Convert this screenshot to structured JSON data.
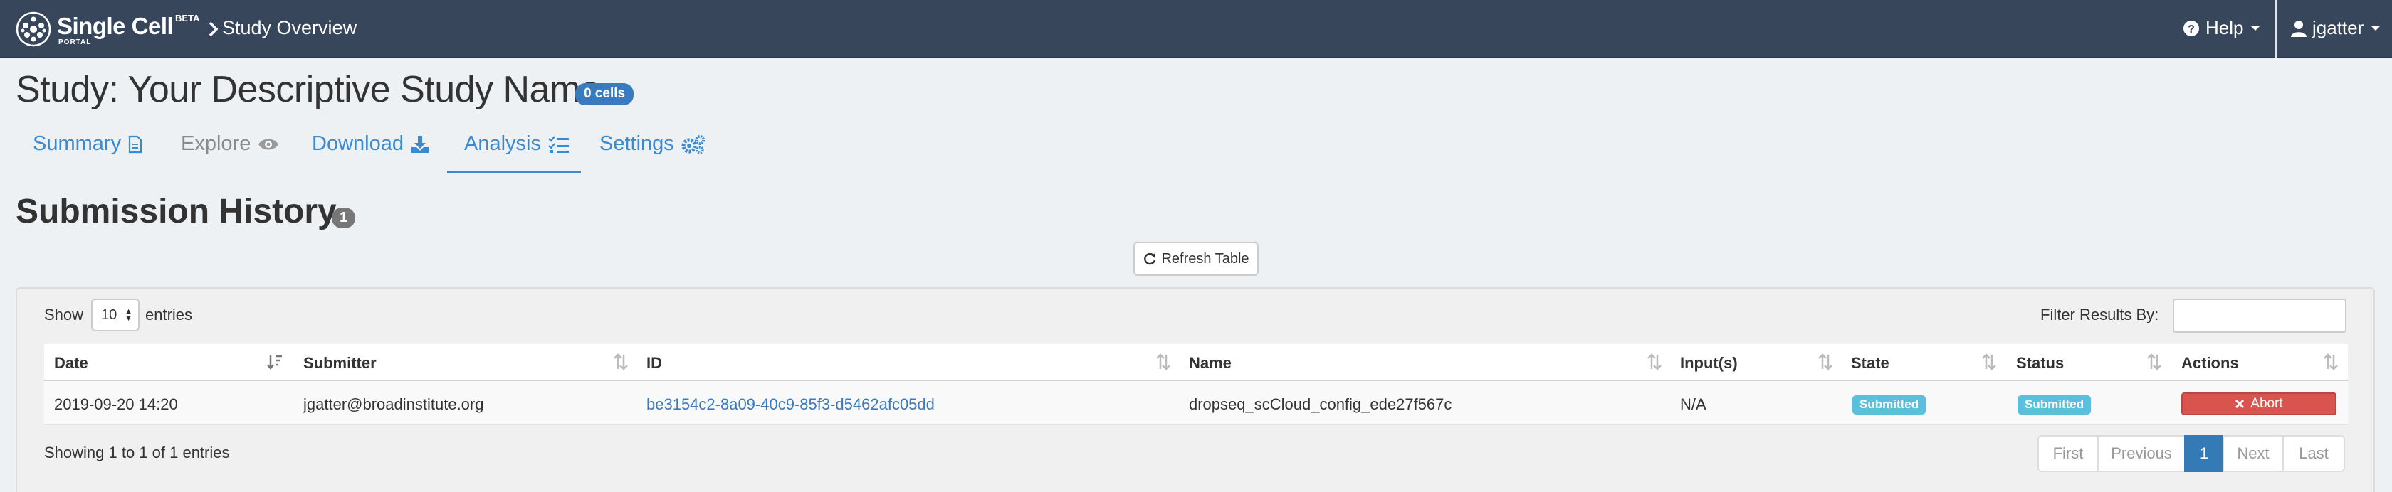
{
  "navbar": {
    "brand_name": "Single Cell",
    "brand_beta": "BETA",
    "brand_portal": "PORTAL",
    "breadcrumb": "Study Overview",
    "help_label": "Help",
    "user_label": "jgatter"
  },
  "study": {
    "title": "Study: Your Descriptive Study Name",
    "cells_badge": "0 cells"
  },
  "tabs": [
    {
      "label": "Summary",
      "icon": "file-icon"
    },
    {
      "label": "Explore",
      "icon": "eye-icon"
    },
    {
      "label": "Download",
      "icon": "download-icon"
    },
    {
      "label": "Analysis",
      "icon": "tasks-icon",
      "active": true
    },
    {
      "label": "Settings",
      "icon": "cogs-icon"
    }
  ],
  "submission_history": {
    "title": "Submission History",
    "count": "1",
    "refresh_label": "Refresh Table",
    "show_label": "Show",
    "entries_per_page": "10",
    "entries_label": "entries",
    "filter_label": "Filter Results By:",
    "filter_value": "",
    "columns": [
      "Date",
      "Submitter",
      "ID",
      "Name",
      "Input(s)",
      "State",
      "Status",
      "Actions"
    ],
    "rows": [
      {
        "date": "2019-09-20 14:20",
        "submitter": "jgatter@broadinstitute.org",
        "id": "be3154c2-8a09-40c9-85f3-d5462afc05dd",
        "name": "dropseq_scCloud_config_ede27f567c",
        "inputs": "N/A",
        "state": "Submitted",
        "status": "Submitted",
        "action_label": "Abort"
      }
    ],
    "info": "Showing 1 to 1 of 1 entries",
    "pagination": {
      "first": "First",
      "previous": "Previous",
      "current": "1",
      "next": "Next",
      "last": "Last"
    }
  },
  "colors": {
    "navbar": "#38465c",
    "link": "#3a8ad1",
    "badge_blue": "#3a7bbf",
    "submitted": "#5bc0de",
    "abort": "#d9534f",
    "page_active": "#337ab7"
  }
}
